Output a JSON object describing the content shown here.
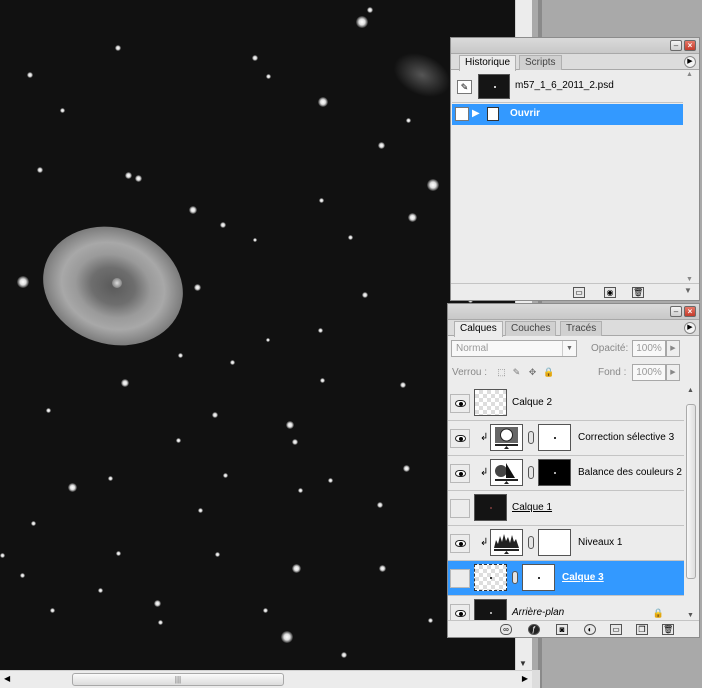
{
  "history_panel": {
    "tabs": [
      {
        "label": "Historique",
        "active": true
      },
      {
        "label": "Scripts",
        "active": false
      }
    ],
    "snapshot": {
      "name": "m57_1_6_2011_2.psd"
    },
    "steps": [
      {
        "label": "Ouvrir",
        "selected": true
      }
    ],
    "footer_icons": [
      "new-document-from-state-icon",
      "camera-icon",
      "trash-icon"
    ]
  },
  "layers_panel": {
    "tabs": [
      {
        "label": "Calques",
        "active": true
      },
      {
        "label": "Couches",
        "active": false
      },
      {
        "label": "Tracés",
        "active": false
      }
    ],
    "blend_mode": "Normal",
    "opacity_label": "Opacité:",
    "opacity_value": "100%",
    "lock_label": "Verrou :",
    "fill_label": "Fond :",
    "fill_value": "100%",
    "layers": [
      {
        "name": "Calque 2",
        "visible": true,
        "thumb": "checker",
        "mask": null,
        "clipped": false,
        "selected": false,
        "locked": false
      },
      {
        "name": "Correction sélective 3",
        "visible": true,
        "thumb": "adj-selective",
        "mask": "white",
        "clipped": true,
        "selected": false,
        "locked": false
      },
      {
        "name": "Balance des couleurs 2",
        "visible": true,
        "thumb": "adj-balance",
        "mask": "black",
        "clipped": true,
        "selected": false,
        "locked": false
      },
      {
        "name": "Calque 1",
        "visible": false,
        "thumb": "dark",
        "mask": null,
        "clipped": false,
        "selected": false,
        "locked": false
      },
      {
        "name": "Niveaux 1",
        "visible": true,
        "thumb": "adj-levels",
        "mask": "white",
        "clipped": true,
        "selected": false,
        "locked": false
      },
      {
        "name": "Calque 3",
        "visible": false,
        "thumb": "checker",
        "mask": "white",
        "clipped": false,
        "selected": true,
        "locked": false
      },
      {
        "name": "Arrière-plan",
        "visible": true,
        "thumb": "dark",
        "mask": null,
        "clipped": false,
        "selected": false,
        "locked": true
      }
    ],
    "footer_icons": [
      "link-icon",
      "fx-icon",
      "mask-icon",
      "adjustment-layer-icon",
      "folder-icon",
      "new-layer-icon",
      "trash-icon"
    ]
  },
  "colors": {
    "selection_blue": "#3399ff",
    "canvas_bg": "#111111",
    "panel_bg": "#ececec"
  }
}
